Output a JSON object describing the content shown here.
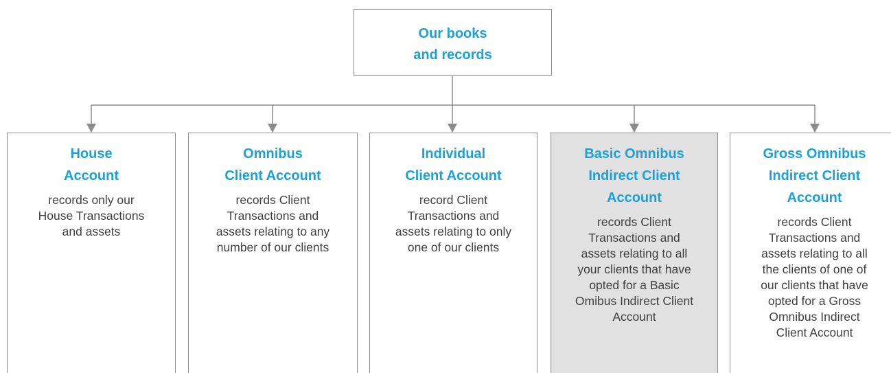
{
  "diagram": {
    "type": "org-chart",
    "colors": {
      "title": "#1aa1db",
      "body_text": "#404040",
      "border": "#8c8c8c",
      "connector": "#8c8c8c",
      "highlight_fill": "#e1e1e1"
    },
    "root": {
      "title": "Our books\nand records"
    },
    "children": [
      {
        "title": "House\nAccount",
        "description": "records only our\nHouse Transactions\nand assets",
        "highlighted": false
      },
      {
        "title": "Omnibus\nClient Account",
        "description": "records Client\nTransactions and\nassets relating to any\nnumber of our clients",
        "highlighted": false
      },
      {
        "title": "Individual\nClient Account",
        "description": "record Client\nTransactions and\nassets relating to only\none of our clients",
        "highlighted": false
      },
      {
        "title": "Basic Omnibus\nIndirect Client\nAccount",
        "description": "records Client\nTransactions and\nassets relating to all\nyour clients that have\nopted for a Basic\nOmibus Indirect Client\nAccount",
        "highlighted": true
      },
      {
        "title": "Gross Omnibus\nIndirect Client\nAccount",
        "description": "records Client\nTransactions and\nassets relating to all\nthe clients of one of\nour clients that have\nopted for a Gross\nOmnibus Indirect\nClient Account",
        "highlighted": false
      }
    ]
  }
}
